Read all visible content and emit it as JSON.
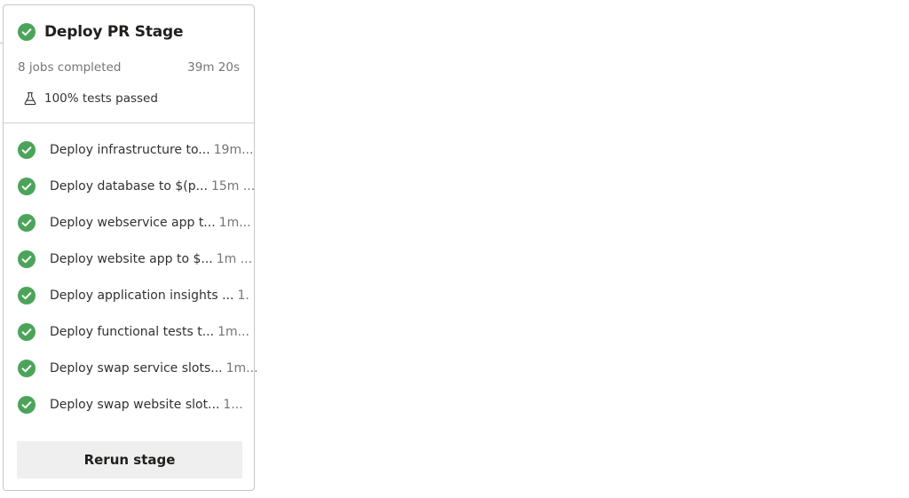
{
  "stage": {
    "title": "Deploy PR Stage",
    "status_icon": "check-circle-icon",
    "status_color": "#4ca45a",
    "jobs_completed": "8 jobs completed",
    "duration": "39m 20s",
    "tests_icon": "flask-icon",
    "tests_passed": "100% tests passed"
  },
  "jobs": [
    {
      "name": "Deploy infrastructure to...",
      "duration": "19m..."
    },
    {
      "name": "Deploy database to $(p...",
      "duration": "15m ..."
    },
    {
      "name": "Deploy webservice app t...",
      "duration": "1m..."
    },
    {
      "name": "Deploy website app to $...",
      "duration": "1m ..."
    },
    {
      "name": "Deploy application insights ...",
      "duration": "1."
    },
    {
      "name": "Deploy functional tests t...",
      "duration": "1m..."
    },
    {
      "name": "Deploy swap service slots...",
      "duration": "1m..."
    },
    {
      "name": "Deploy swap website slot...",
      "duration": "1..."
    }
  ],
  "actions": {
    "rerun_label": "Rerun stage"
  }
}
